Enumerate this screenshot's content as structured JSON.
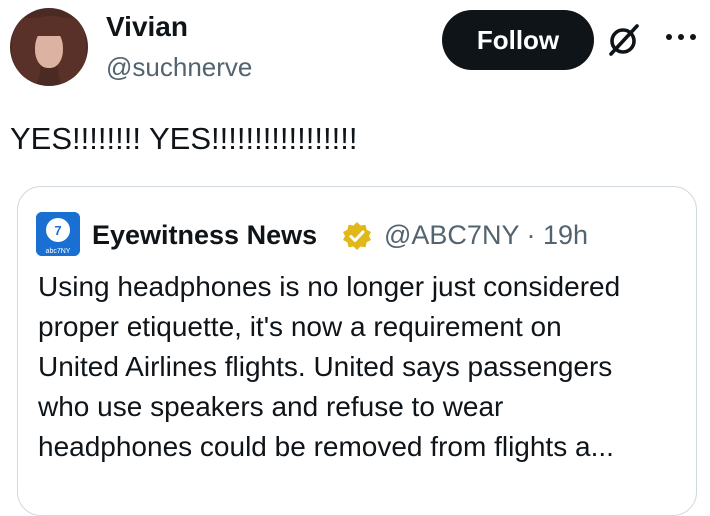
{
  "author": {
    "name": "Vivian",
    "handle": "@suchnerve"
  },
  "actions": {
    "follow_label": "Follow"
  },
  "tweet": {
    "text": "YES!!!!!!!! YES!!!!!!!!!!!!!!!!!"
  },
  "quoted_tweet": {
    "author_name": "Eyewitness News",
    "handle": "@ABC7NY",
    "separator": "·",
    "time": "19h",
    "avatar_text": "abc7NY",
    "body_lines": [
      "Using headphones is no longer just considered",
      "proper etiquette, it's now a requirement on",
      "United Airlines flights. United says passengers",
      "who use speakers and refuse to wear",
      "headphones could be removed from flights a..."
    ]
  },
  "colors": {
    "follow_bg": "#0f1419",
    "secondary_text": "#536471",
    "verified_gold": "#e2b719",
    "quote_border": "#cfd9de",
    "abc_blue": "#1a6fd3"
  },
  "icons": [
    "grok-icon",
    "more-horizontal-icon",
    "verified-badge-icon"
  ]
}
